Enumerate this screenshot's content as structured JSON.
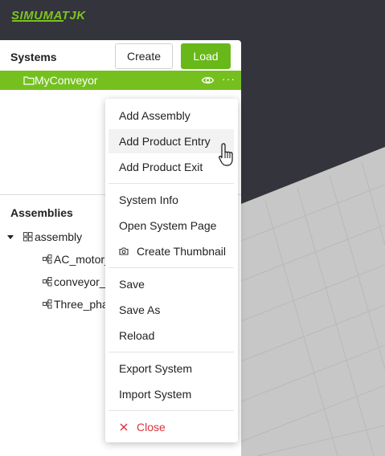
{
  "app": {
    "logo_text": "SIMUMATJK",
    "accent_color": "#75c01f",
    "danger_color": "#d9323c"
  },
  "systems": {
    "title": "Systems",
    "create_label": "Create",
    "load_label": "Load",
    "selected_system": {
      "name": "MyConveyor",
      "folder_icon": "folder-icon",
      "visibility_icon": "eye-icon",
      "more_icon": "more-icon",
      "more_glyph": "···"
    }
  },
  "assemblies": {
    "title": "Assemblies",
    "root": {
      "label": "assembly",
      "icon": "assembly-grid-icon"
    },
    "children": [
      {
        "label": "AC_motor_",
        "icon": "component-icon"
      },
      {
        "label": "conveyor_l",
        "icon": "component-icon"
      },
      {
        "label": "Three_phas",
        "icon": "component-icon"
      }
    ]
  },
  "context_menu": {
    "groups": [
      [
        {
          "label": "Add Assembly"
        },
        {
          "label": "Add Product Entry",
          "hovered": true
        },
        {
          "label": "Add Product Exit"
        }
      ],
      [
        {
          "label": "System Info"
        },
        {
          "label": "Open System Page"
        },
        {
          "label": "Create Thumbnail",
          "icon": "camera-icon"
        }
      ],
      [
        {
          "label": "Save"
        },
        {
          "label": "Save As"
        },
        {
          "label": "Reload"
        }
      ],
      [
        {
          "label": "Export System"
        },
        {
          "label": "Import System"
        }
      ],
      [
        {
          "label": "Close",
          "icon": "close-icon",
          "danger": true
        }
      ]
    ]
  }
}
